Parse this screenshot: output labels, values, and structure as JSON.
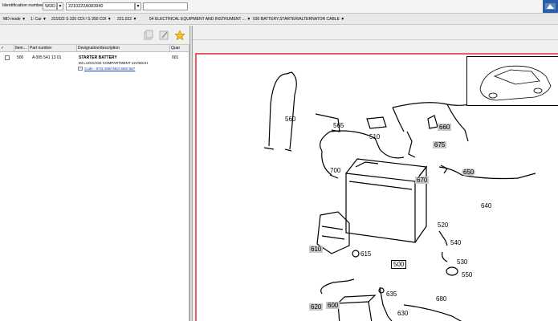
{
  "header": {
    "id_label": "Identification number",
    "id_prefix": "WDD",
    "id_prefix_arrow": "▼",
    "id_value": "2210222A083940",
    "id_value_arrow": "▼"
  },
  "breadcrumb": [
    {
      "label": "MD mode",
      "arrow": "▼"
    },
    {
      "label": "1: Car",
      "arrow": "▼"
    },
    {
      "label": "221022 S 320 CDI / S 350 CDI",
      "arrow": "▼"
    },
    {
      "label": "221.022",
      "arrow": "▼"
    },
    {
      "label": "54 ELECTRICAL EQUIPMENT AND INSTRUMENT ...",
      "arrow": "▼"
    },
    {
      "label": "030 BATTERY,STARTER/ALTERNATOR CABLE",
      "arrow": "▼"
    }
  ],
  "toolbar": {
    "icons": [
      "copy-icon",
      "edit-icon",
      "favorite-star-icon"
    ],
    "star_color": "#e0a400"
  },
  "table": {
    "columns": [
      "✓",
      "Item...",
      "Part number",
      "Designation/description",
      "Quar"
    ],
    "rows": [
      {
        "item": "500",
        "part_number": "A 005 541 13 01",
        "designation": "STARTER BATTERY",
        "description": "IM LUGGAGE COMPARTMENT 12V/60AH",
        "code_link": "Code : 873(-308/-582/-550/-587",
        "quantity": "001"
      }
    ]
  },
  "diagram": {
    "callouts": [
      "560",
      "565",
      "510",
      "660",
      "675",
      "650",
      "670",
      "700",
      "640",
      "520",
      "540",
      "530",
      "550",
      "610",
      "615",
      "500",
      "635",
      "620",
      "600",
      "680",
      "630"
    ],
    "selected": "500",
    "highlight_color": "#e06060"
  }
}
